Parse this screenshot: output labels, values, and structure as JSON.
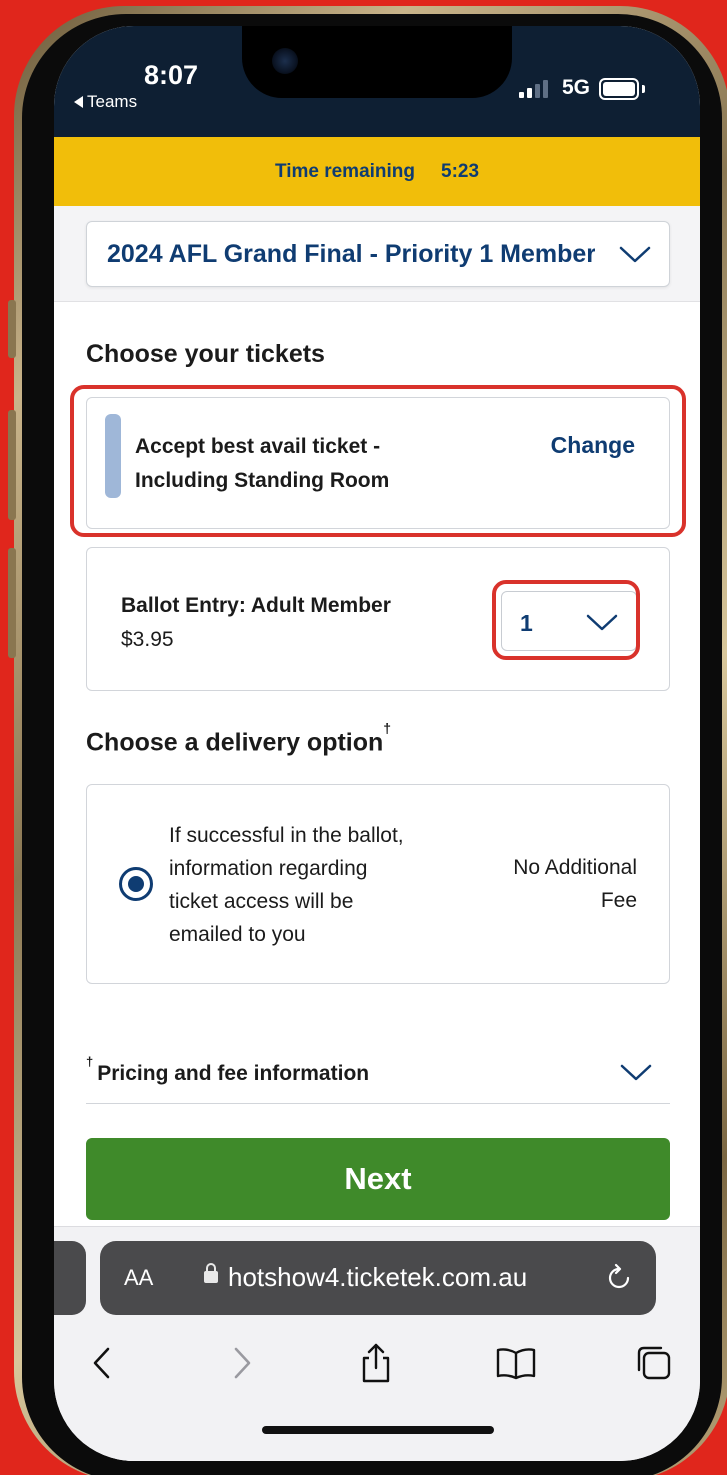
{
  "status_bar": {
    "time": "8:07",
    "back_app": "Teams",
    "network": "5G"
  },
  "timer": {
    "label": "Time remaining",
    "value": "5:23"
  },
  "event": {
    "selected": "2024 AFL Grand Final - Priority 1 Member"
  },
  "tickets": {
    "heading": "Choose your tickets",
    "selection_line1": "Accept best avail ticket -",
    "selection_line2": "Including Standing Room",
    "change_label": "Change",
    "ballot_name": "Ballot Entry: Adult Member",
    "ballot_price": "$3.95",
    "quantity": "1"
  },
  "delivery": {
    "heading": "Choose a delivery option",
    "heading_mark": "†",
    "option_line1": "If successful in the ballot,",
    "option_line2": "information regarding",
    "option_line3": "ticket access will be",
    "option_line4": "emailed to you",
    "fee_line1": "No Additional",
    "fee_line2": "Fee",
    "selected": true
  },
  "pricing": {
    "mark": "†",
    "label": "Pricing and fee information"
  },
  "next_button": {
    "label": "Next",
    "color": "#3f8a2a"
  },
  "browser": {
    "aa_label": "AA",
    "url": "hotshow4.ticketek.com.au"
  },
  "colors": {
    "brand_navy": "#0f3c72",
    "timer_yellow": "#f1be0a",
    "highlight_red": "#d9322b",
    "background_red": "#e0261c"
  }
}
